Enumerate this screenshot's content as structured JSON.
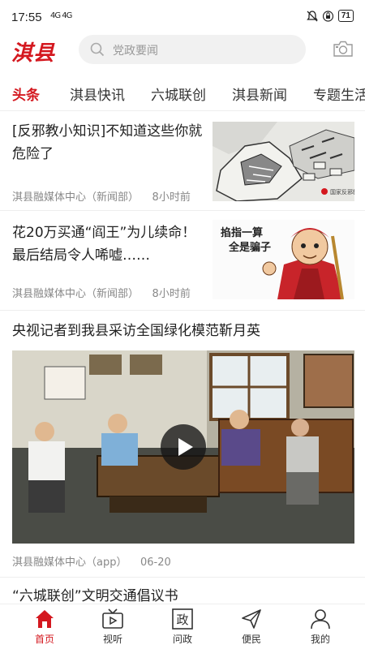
{
  "status_bar": {
    "time": "17:55",
    "network": "4G 4G",
    "battery": "71"
  },
  "header": {
    "logo_text": "淇县",
    "search_placeholder": "党政要闻"
  },
  "tabs": [
    {
      "label": "头条",
      "active": true
    },
    {
      "label": "淇县快讯"
    },
    {
      "label": "六城联创"
    },
    {
      "label": "淇县新闻"
    },
    {
      "label": "专题生活"
    }
  ],
  "feed": [
    {
      "title": "[反邪教小知识]不知道这些你就危险了",
      "source": "淇县融媒体中心（新闻部）",
      "time": "8小时前",
      "thumb_label": "国家反邪教网"
    },
    {
      "title": "花20万买通“阎王”为儿续命！最后结局令人唏嘘……",
      "source": "淇县融媒体中心（新闻部）",
      "time": "8小时前",
      "thumb_text_1": "掐指一算",
      "thumb_text_2": "全是骗子"
    },
    {
      "title": "央视记者到我县采访全国绿化模范靳月英",
      "source": "淇县融媒体中心（app）",
      "time": "06-20"
    },
    {
      "title": "“六城联创”文明交通倡议书"
    }
  ],
  "bottom_nav": [
    {
      "label": "首页",
      "icon": "home-icon",
      "active": true
    },
    {
      "label": "视听",
      "icon": "tv-icon"
    },
    {
      "label": "问政",
      "icon": "inquiry-icon",
      "glyph": "政"
    },
    {
      "label": "便民",
      "icon": "send-icon"
    },
    {
      "label": "我的",
      "icon": "user-icon"
    }
  ],
  "colors": {
    "accent": "#d4181f",
    "meta": "#888888"
  }
}
